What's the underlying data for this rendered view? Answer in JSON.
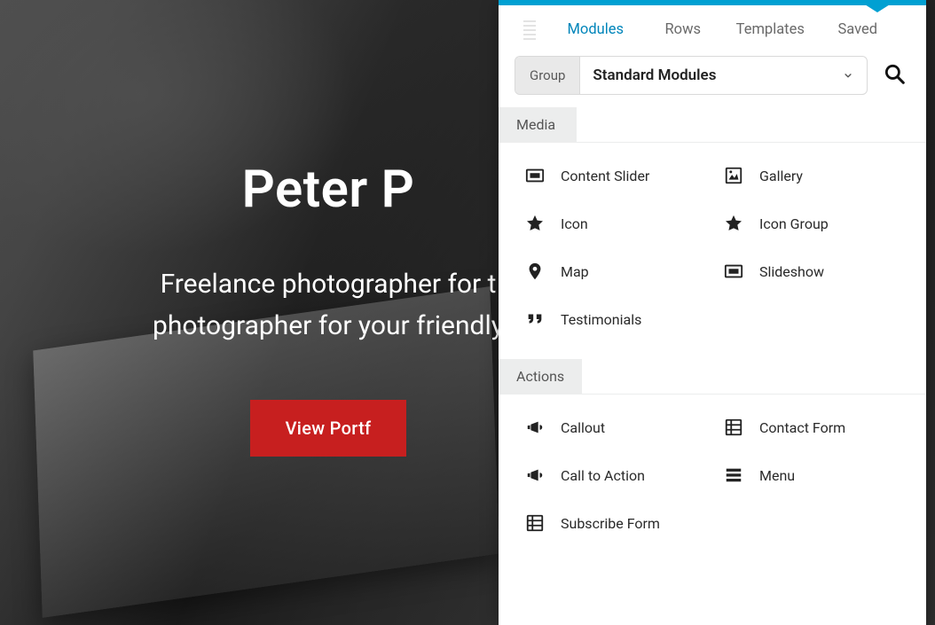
{
  "hero": {
    "title": "Peter P",
    "subtitle_line1": "Freelance photographer for t",
    "subtitle_line2": "photographer for your friendly",
    "cta": "View Portf"
  },
  "panel": {
    "tabs": [
      {
        "label": "Modules",
        "active": true
      },
      {
        "label": "Rows",
        "active": false
      },
      {
        "label": "Templates",
        "active": false
      },
      {
        "label": "Saved",
        "active": false
      }
    ],
    "filter": {
      "group_label": "Group",
      "selected": "Standard Modules"
    },
    "sections": [
      {
        "title": "Media",
        "items": [
          {
            "icon": "slider",
            "label": "Content Slider"
          },
          {
            "icon": "gallery",
            "label": "Gallery"
          },
          {
            "icon": "star",
            "label": "Icon"
          },
          {
            "icon": "star",
            "label": "Icon Group"
          },
          {
            "icon": "map-pin",
            "label": "Map"
          },
          {
            "icon": "slider",
            "label": "Slideshow"
          },
          {
            "icon": "quote",
            "label": "Testimonials"
          }
        ]
      },
      {
        "title": "Actions",
        "items": [
          {
            "icon": "bullhorn",
            "label": "Callout"
          },
          {
            "icon": "form",
            "label": "Contact Form"
          },
          {
            "icon": "bullhorn",
            "label": "Call to Action"
          },
          {
            "icon": "menu",
            "label": "Menu"
          },
          {
            "icon": "form",
            "label": "Subscribe Form"
          }
        ]
      }
    ]
  }
}
